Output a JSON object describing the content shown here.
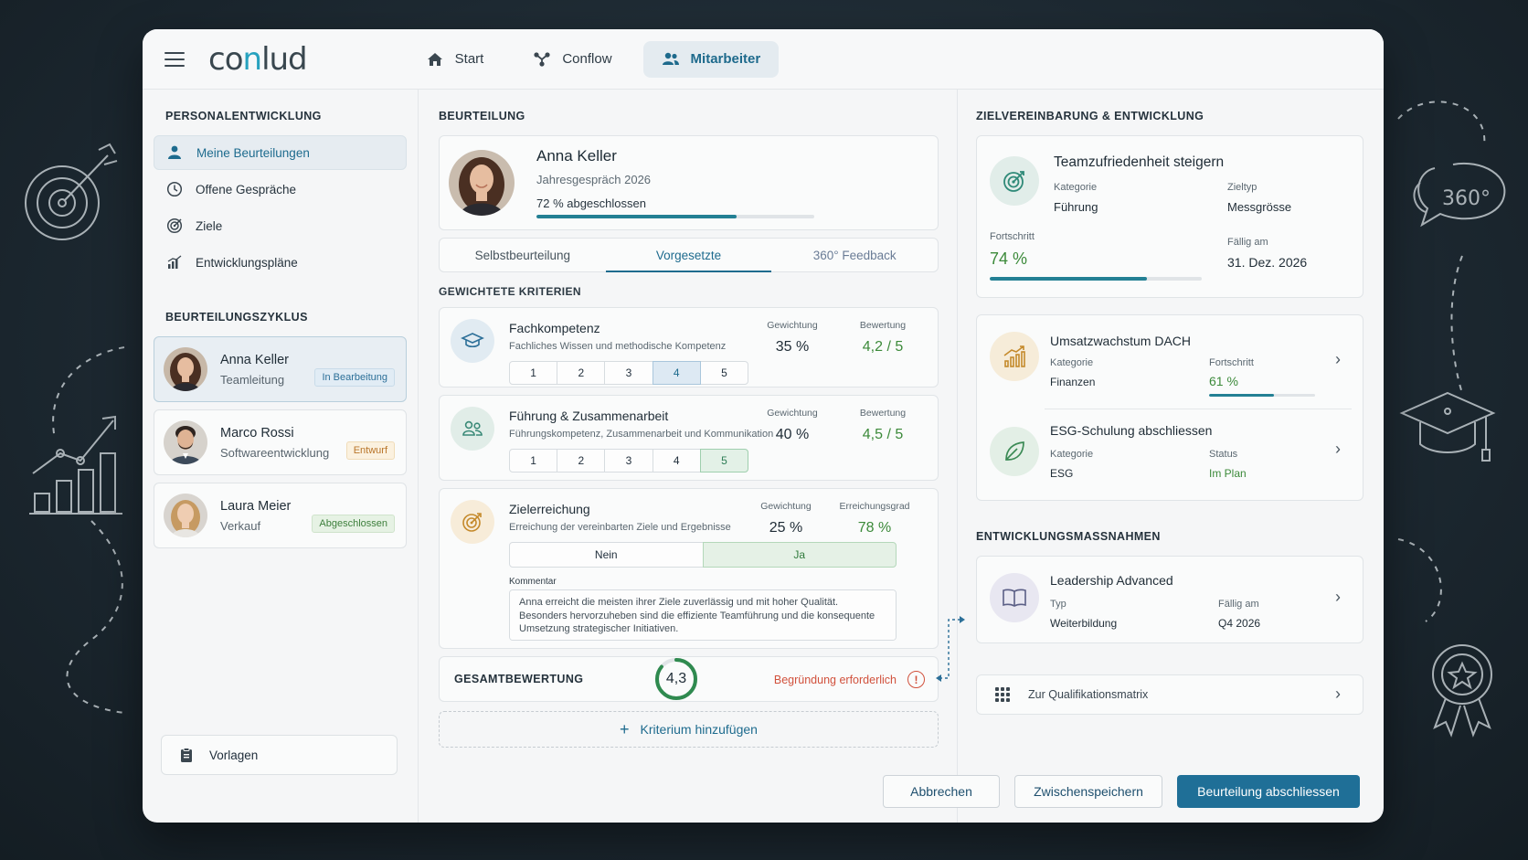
{
  "app": {
    "logo_main": "co",
    "logo_accent": "n",
    "logo_end": "lud"
  },
  "nav": [
    {
      "label": "Start",
      "icon": "home-icon"
    },
    {
      "label": "Conflow",
      "icon": "flow-icon"
    },
    {
      "label": "Mitarbeiter",
      "icon": "users-icon",
      "active": true
    }
  ],
  "sidebar": {
    "section_title": "PERSONALENTWICKLUNG",
    "items": [
      {
        "label": "Meine Beurteilungen",
        "icon": "user-icon"
      },
      {
        "label": "Offene Gespräche",
        "icon": "clock-icon"
      },
      {
        "label": "Ziele",
        "icon": "target-icon"
      },
      {
        "label": "Entwicklungspläne",
        "icon": "chart-icon"
      }
    ],
    "cycle_title": "BEURTEILUNGSZYKLUS",
    "people": [
      {
        "name": "Anna Keller",
        "role": "Teamleitung",
        "status": "In Bearbeitung"
      },
      {
        "name": "Marco Rossi",
        "role": "Softwareentwicklung",
        "status": "Entwurf"
      },
      {
        "name": "Laura Meier",
        "role": "Verkauf",
        "status": "Abgeschlossen"
      }
    ],
    "templates_label": "Vorlagen"
  },
  "main": {
    "title": "BEURTEILUNG",
    "employee": {
      "name": "Anna Keller",
      "subtitle": "Jahresgespräch 2026",
      "progress_label": "72 % abgeschlossen",
      "progress": 0.72
    },
    "tabs": [
      "Selbstbeurteilung",
      "Vorgesetzte",
      "360° Feedback"
    ],
    "criteria_title": "GEWICHTETE KRITERIEN",
    "criteria": [
      {
        "name": "Fachkompetenz",
        "desc": "Fachliches Wissen und methodische Kompetenz",
        "weight_label": "Gewichtung",
        "weight": "35 %",
        "rating_label": "Bewertung",
        "rating": "4,2 / 5",
        "scale": [
          "1",
          "2",
          "3",
          "4",
          "5"
        ],
        "selected": 4
      },
      {
        "name": "Führung & Zusammenarbeit",
        "desc": "Führungskompetenz, Zusammenarbeit und Kommunikation",
        "weight_label": "Gewichtung",
        "weight": "40 %",
        "rating_label": "Bewertung",
        "rating": "4,5 / 5",
        "scale": [
          "1",
          "2",
          "3",
          "4",
          "5"
        ],
        "selected": 5
      },
      {
        "name": "Zielerreichung",
        "desc": "Erreichung der vereinbarten Ziele und Ergebnisse",
        "weight_label": "Gewichtung",
        "weight": "25 %",
        "rating_label": "Erreichungsgrad",
        "rating": "78 %",
        "no_label": "Nein",
        "yes_label": "Ja",
        "comment_label": "Kommentar",
        "comment": "Anna erreicht die meisten ihrer Ziele zuverlässig und mit hoher Qualität. Besonders hervorzuheben sind die effiziente Teamführung und die konsequente Umsetzung strategischer Initiativen."
      }
    ],
    "total_label": "GESAMTBEWERTUNG",
    "total_value": "4,3",
    "total_fraction": 0.86,
    "warning": "Begründung erforderlich",
    "add_label": "Kriterium hinzufügen"
  },
  "right": {
    "title": "ZIELVEREINBARUNG & ENTWICKLUNG",
    "goal_main": {
      "title": "Teamzufriedenheit steigern",
      "cat_label": "Kategorie",
      "cat": "Führung",
      "type_label": "Zieltyp",
      "type": "Messgrösse",
      "prog_label": "Fortschritt",
      "prog": "74 %",
      "progress": 0.74,
      "due_label": "Fällig am",
      "due": "31. Dez. 2026"
    },
    "goals": [
      {
        "title": "Umsatzwachstum DACH",
        "cat_label": "Kategorie",
        "cat": "Finanzen",
        "prog_label": "Fortschritt",
        "prog": "61 %",
        "progress": 0.61
      },
      {
        "title": "ESG-Schulung abschliessen",
        "cat_label": "Kategorie",
        "cat": "ESG",
        "status_label": "Status",
        "status": "Im Plan"
      }
    ],
    "dev_title": "ENTWICKLUNGSMASSNAHMEN",
    "dev": {
      "title": "Leadership Advanced",
      "type_label": "Typ",
      "type": "Weiterbildung",
      "due_label": "Fällig am",
      "due": "Q4 2026"
    },
    "matrix_label": "Zur Qualifikationsmatrix"
  },
  "footer": {
    "cancel": "Abbrechen",
    "save": "Zwischenspeichern",
    "finish": "Beurteilung abschliessen"
  },
  "colors": {
    "accent": "#1f6f97",
    "progress": "#238094",
    "success": "#3c8a3a",
    "warning": "#d1513c"
  },
  "decor": {
    "badge_360": "360°"
  }
}
